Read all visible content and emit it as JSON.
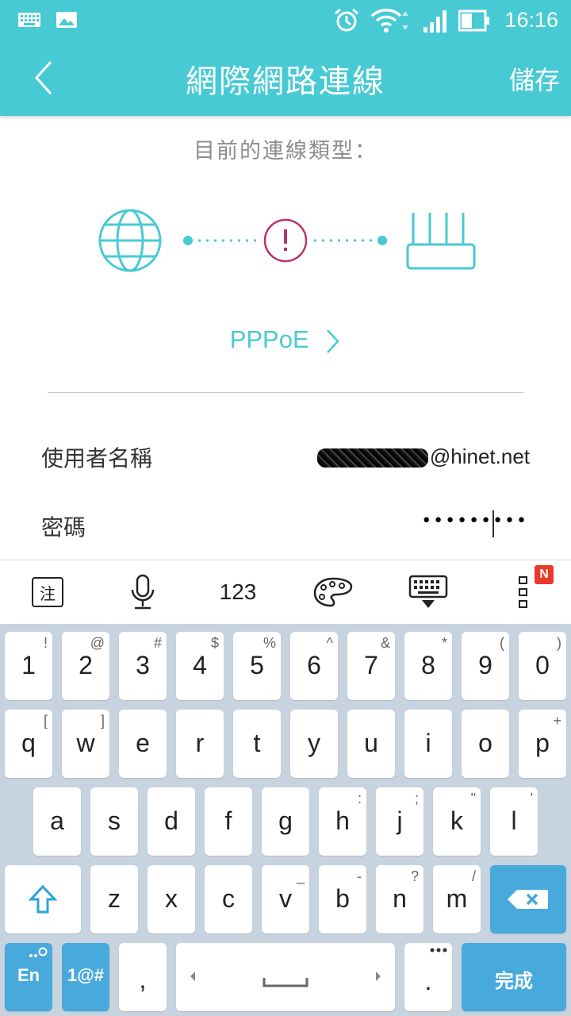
{
  "status": {
    "time": "16:16"
  },
  "appbar": {
    "title": "網際網路連線",
    "save_label": "儲存"
  },
  "main": {
    "subtitle": "目前的連線類型：",
    "connection_type": "PPPoE",
    "colors": {
      "accent": "#48cad4",
      "warning": "#b8336a"
    }
  },
  "form": {
    "username_label": "使用者名稱",
    "username_value": "@hinet.net",
    "password_label": "密碼",
    "password_value": "•••••••••"
  },
  "keyboard_toolbar": {
    "zhuyin": "注",
    "numbers": "123",
    "badge": "N"
  },
  "keyboard": {
    "row1": [
      {
        "m": "1",
        "s": "!"
      },
      {
        "m": "2",
        "s": "@"
      },
      {
        "m": "3",
        "s": "#"
      },
      {
        "m": "4",
        "s": "$"
      },
      {
        "m": "5",
        "s": "%"
      },
      {
        "m": "6",
        "s": "^"
      },
      {
        "m": "7",
        "s": "&"
      },
      {
        "m": "8",
        "s": "*"
      },
      {
        "m": "9",
        "s": "("
      },
      {
        "m": "0",
        "s": ")"
      }
    ],
    "row2": [
      {
        "m": "q",
        "s": "["
      },
      {
        "m": "w",
        "s": "]"
      },
      {
        "m": "e",
        "s": ""
      },
      {
        "m": "r",
        "s": ""
      },
      {
        "m": "t",
        "s": ""
      },
      {
        "m": "y",
        "s": ""
      },
      {
        "m": "u",
        "s": ""
      },
      {
        "m": "i",
        "s": ""
      },
      {
        "m": "o",
        "s": ""
      },
      {
        "m": "p",
        "s": "+"
      }
    ],
    "row3": [
      {
        "m": "a",
        "s": ""
      },
      {
        "m": "s",
        "s": ""
      },
      {
        "m": "d",
        "s": ""
      },
      {
        "m": "f",
        "s": ""
      },
      {
        "m": "g",
        "s": ""
      },
      {
        "m": "h",
        "s": ":"
      },
      {
        "m": "j",
        "s": ";"
      },
      {
        "m": "k",
        "s": "\""
      },
      {
        "m": "l",
        "s": "'"
      }
    ],
    "row4": [
      {
        "m": "z",
        "s": ""
      },
      {
        "m": "x",
        "s": ""
      },
      {
        "m": "c",
        "s": ""
      },
      {
        "m": "v",
        "s": "_"
      },
      {
        "m": "b",
        "s": "-"
      },
      {
        "m": "n",
        "s": "?"
      },
      {
        "m": "m",
        "s": "/"
      }
    ],
    "lang_label": "En",
    "symbols_label": "1@#",
    "comma": ",",
    "period": ".",
    "done_label": "完成"
  }
}
